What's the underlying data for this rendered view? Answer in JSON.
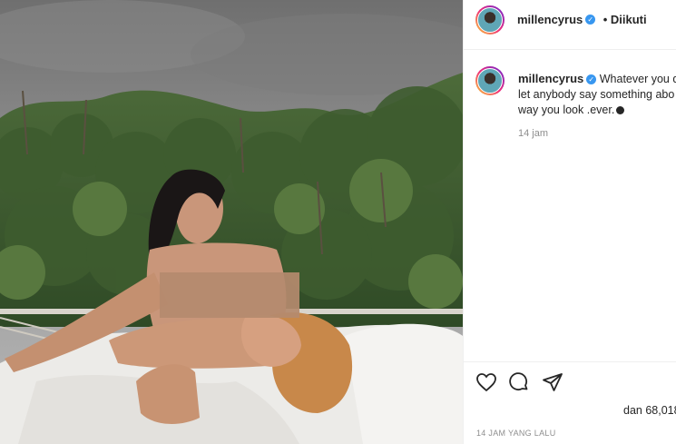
{
  "post": {
    "image_alt": "Two women lying on a bed on a balcony overlooking a tropical palm jungle",
    "censor_color": "#b48a6e"
  },
  "header": {
    "username": "millencyrus",
    "dot_follow": "• Diikuti"
  },
  "caption": {
    "username": "millencyrus",
    "line1": "Whatever you d",
    "line2": "let anybody say something abo",
    "line3": "way you look .ever.",
    "timestamp": "14 jam"
  },
  "actions": {
    "like": "heart-icon",
    "comment": "comment-icon",
    "share": "share-icon"
  },
  "likes": {
    "text": "dan 68,018"
  },
  "footer": {
    "ago": "14 JAM YANG LALU"
  },
  "colors": {
    "verified": "#3897f0",
    "muted": "#8e8e8e",
    "text": "#262626"
  }
}
